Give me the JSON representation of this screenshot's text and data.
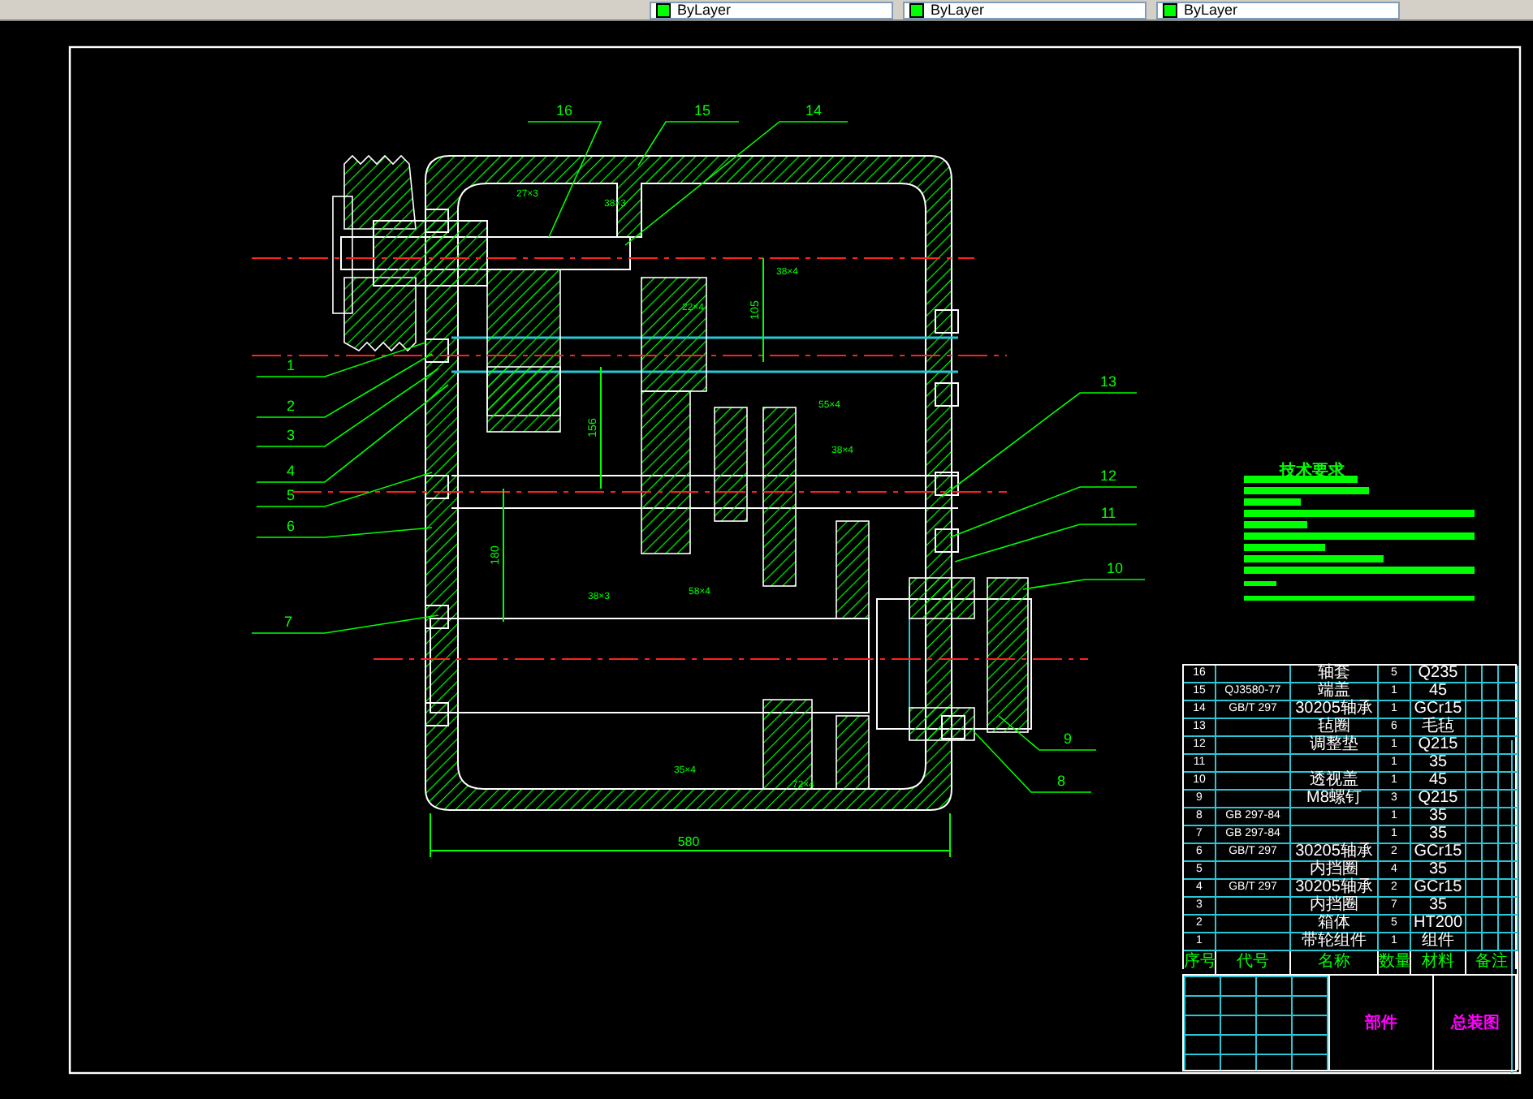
{
  "toolbar": {
    "linetype_boxes": [
      "ByLayer",
      "ByLayer",
      "ByLayer"
    ]
  },
  "drawing": {
    "balloons": [
      "16",
      "15",
      "14",
      "1",
      "13",
      "2",
      "3",
      "4",
      "12",
      "5",
      "11",
      "6",
      "10",
      "7",
      "9",
      "8"
    ],
    "overall_dimension": "580",
    "center_distances": [
      "156",
      "180",
      "105"
    ],
    "gear_labels": [
      "27×3",
      "38×3",
      "38×4",
      "22×4",
      "55×4",
      "38×4",
      "38×3",
      "58×4",
      "35×4",
      "72×4"
    ]
  },
  "tech_requirements": {
    "title": "技术要求"
  },
  "parts_table": {
    "rows": [
      {
        "no": "16",
        "code": "",
        "name": "轴套",
        "qty": "5",
        "material": "Q235"
      },
      {
        "no": "15",
        "code": "QJ3580-77",
        "name": "端盖",
        "qty": "1",
        "material": "45"
      },
      {
        "no": "14",
        "code": "GB/T 297",
        "name": "30205轴承",
        "qty": "1",
        "material": "GCr15"
      },
      {
        "no": "13",
        "code": "",
        "name": "毡圈",
        "qty": "6",
        "material": "毛毡"
      },
      {
        "no": "12",
        "code": "",
        "name": "调整垫",
        "qty": "1",
        "material": "Q215"
      },
      {
        "no": "11",
        "code": "",
        "name": "",
        "qty": "1",
        "material": "35"
      },
      {
        "no": "10",
        "code": "",
        "name": "透视盖",
        "qty": "1",
        "material": "45"
      },
      {
        "no": "9",
        "code": "",
        "name": "M8螺钉",
        "qty": "3",
        "material": "Q215"
      },
      {
        "no": "8",
        "code": "GB 297-84",
        "name": "",
        "qty": "1",
        "material": "35"
      },
      {
        "no": "7",
        "code": "GB 297-84",
        "name": "",
        "qty": "1",
        "material": "35"
      },
      {
        "no": "6",
        "code": "GB/T 297",
        "name": "30205轴承",
        "qty": "2",
        "material": "GCr15"
      },
      {
        "no": "5",
        "code": "",
        "name": "内挡圈",
        "qty": "4",
        "material": "35"
      },
      {
        "no": "4",
        "code": "GB/T 297",
        "name": "30205轴承",
        "qty": "2",
        "material": "GCr15"
      },
      {
        "no": "3",
        "code": "",
        "name": "内挡圈",
        "qty": "7",
        "material": "35"
      },
      {
        "no": "2",
        "code": "",
        "name": "箱体",
        "qty": "5",
        "material": "HT200"
      },
      {
        "no": "1",
        "code": "",
        "name": "带轮组件",
        "qty": "1",
        "material": "组件"
      }
    ],
    "header": [
      "序号",
      "代号",
      "名称",
      "数量",
      "材料",
      "备注"
    ]
  },
  "title_block": {
    "part": "部件",
    "drawing_name": "总装图"
  }
}
